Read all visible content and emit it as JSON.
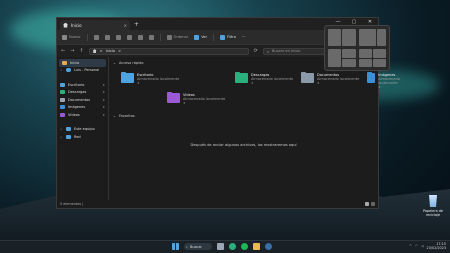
{
  "window": {
    "tab_title": "Inicio",
    "newtab_glyph": "+",
    "close_tab_glyph": "×",
    "controls": [
      "—",
      "▢",
      "✕"
    ]
  },
  "toolbar": {
    "new_label": "Nuevo",
    "sort_label": "Ordenar",
    "view_label": "Ver",
    "filter_label": "Filtro",
    "more_label": "···"
  },
  "address": {
    "back": "←",
    "forward": "→",
    "up": "↑",
    "refresh": "⟳",
    "path_root": "Inicio",
    "path_chevron": ">",
    "search_placeholder": "Buscar en Inicio"
  },
  "sidebar": {
    "items": [
      {
        "label": "Inicio",
        "selected": true,
        "icon": "home-icon",
        "color": "#e9a94b"
      },
      {
        "label": "Luis - Personal",
        "icon": "cloud-icon",
        "color": "#4fa3e0",
        "chevron": ">"
      },
      {
        "label": "Escritorio",
        "icon": "desktop-icon",
        "color": "#4fa3e0",
        "pinned": true
      },
      {
        "label": "Descargas",
        "icon": "download-icon",
        "color": "#2ab07d",
        "pinned": true
      },
      {
        "label": "Documentos",
        "icon": "document-icon",
        "color": "#9aa6b4",
        "pinned": true
      },
      {
        "label": "Imágenes",
        "icon": "image-icon",
        "color": "#3b8ed8",
        "pinned": true
      },
      {
        "label": "Vídeos",
        "icon": "video-icon",
        "color": "#9b59d6",
        "pinned": true
      },
      {
        "label": "Este equipo",
        "icon": "pc-icon",
        "color": "#4fa3e0",
        "chevron": ">"
      },
      {
        "label": "Red",
        "icon": "network-icon",
        "color": "#4fa3e0",
        "chevron": ">"
      }
    ],
    "pin_glyph": "✶"
  },
  "main": {
    "quick_access_title": "Acceso rápido",
    "favorites_title": "Favoritos",
    "quick_access": [
      {
        "name": "Escritorio",
        "sub": "Almacenado localmente",
        "color": "#4fa3e0"
      },
      {
        "name": "Descargas",
        "sub": "Almacenado localmente",
        "color": "#2ab07d"
      },
      {
        "name": "Documentos",
        "sub": "Almacenado localmente",
        "color": "#8b9aab"
      },
      {
        "name": "Imágenes",
        "sub": "Almacenado localmente",
        "color": "#3b8ed8"
      },
      {
        "name": "Vídeos",
        "sub": "Almacenado localmente",
        "color": "#9b59d6"
      }
    ],
    "empty_message": "Después de anclar algunos archivos, los mostraremos aquí"
  },
  "status": {
    "items_text": "5 elementos |"
  },
  "desktop": {
    "recycle_label_1": "Papelera de",
    "recycle_label_2": "reciclaje"
  },
  "taskbar": {
    "search_label": "Buscar",
    "apps": [
      {
        "name": "start-icon",
        "color": "#4fa3e0"
      },
      {
        "name": "task-view-icon",
        "color": "#9aa6b4"
      },
      {
        "name": "edge-icon",
        "color": "#2ab07d"
      },
      {
        "name": "spotify-icon",
        "color": "#1db954"
      },
      {
        "name": "explorer-icon",
        "color": "#e9b949"
      },
      {
        "name": "steam-icon",
        "color": "#3a6ea5"
      }
    ],
    "tray_glyph": "^",
    "time": "17:15",
    "date": "23/02/2023"
  }
}
